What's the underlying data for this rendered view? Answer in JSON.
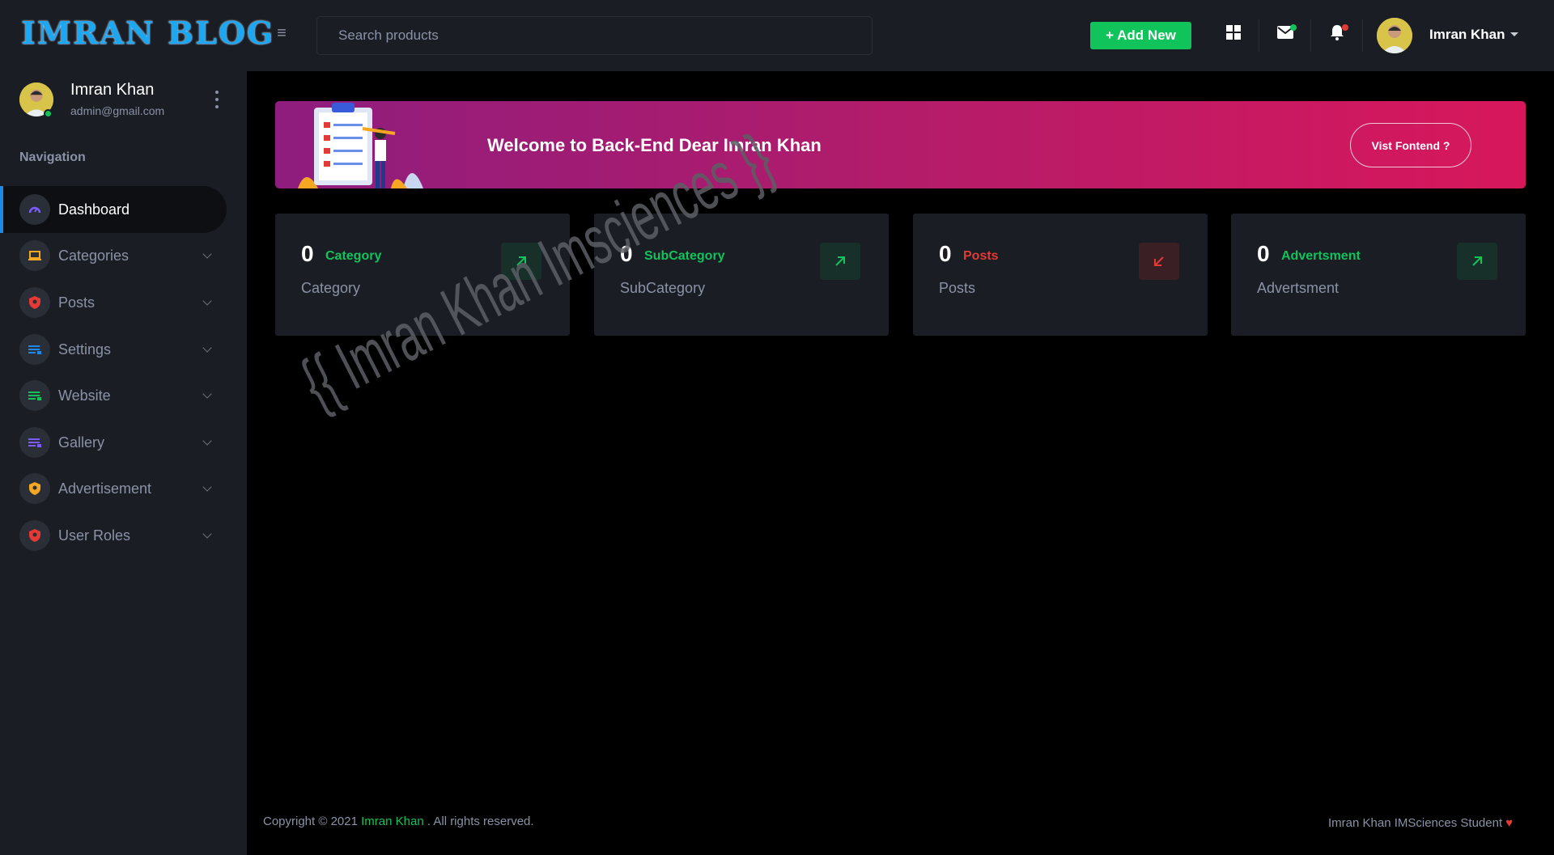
{
  "header": {
    "logo": "IMRAN BLOG",
    "search_placeholder": "Search products",
    "add_new_label": "+ Add New",
    "user_name": "Imran Khan",
    "icons": [
      "hamburger-icon",
      "grid-icon",
      "mail-icon",
      "bell-icon"
    ],
    "colors": {
      "accent_green": "#10c35a",
      "notification_red": "#e53935",
      "logo_blue": "#1da7f0"
    }
  },
  "sidebar": {
    "user_name": "Imran Khan",
    "user_email": "admin@gmail.com",
    "nav_title": "Navigation",
    "items": [
      {
        "label": "Dashboard",
        "icon": "speedometer-icon",
        "icon_color": "#7c5cff",
        "active": true
      },
      {
        "label": "Categories",
        "icon": "laptop-icon",
        "icon_color": "#f5a623",
        "active": false
      },
      {
        "label": "Posts",
        "icon": "shield-icon",
        "icon_color": "#e53935",
        "active": false
      },
      {
        "label": "Settings",
        "icon": "list-icon",
        "icon_color": "#1e88e5",
        "active": false
      },
      {
        "label": "Website",
        "icon": "list-icon",
        "icon_color": "#10c35a",
        "active": false
      },
      {
        "label": "Gallery",
        "icon": "list-icon",
        "icon_color": "#7c5cff",
        "active": false
      },
      {
        "label": "Advertisement",
        "icon": "shield-icon",
        "icon_color": "#f5a623",
        "active": false
      },
      {
        "label": "User Roles",
        "icon": "shield-icon",
        "icon_color": "#e53935",
        "active": false
      }
    ]
  },
  "banner": {
    "welcome_text": "Welcome to Back-End Dear Imran Khan",
    "button_label": "Vist Fontend ?"
  },
  "cards": [
    {
      "count": "0",
      "tag": "Category",
      "subtitle": "Category",
      "tag_color": "#10c35a",
      "trend": "up"
    },
    {
      "count": "0",
      "tag": "SubCategory",
      "subtitle": "SubCategory",
      "tag_color": "#10c35a",
      "trend": "up"
    },
    {
      "count": "0",
      "tag": "Posts",
      "subtitle": "Posts",
      "tag_color": "#e53935",
      "trend": "down"
    },
    {
      "count": "0",
      "tag": "Advertsment",
      "subtitle": "Advertsment",
      "tag_color": "#10c35a",
      "trend": "up"
    }
  ],
  "watermark": "{{ Imran Khan Imsciences }}",
  "footer": {
    "copyright_prefix": "Copyright © 2021",
    "copyright_name": "Imran Khan",
    "copyright_suffix": ". All rights reserved.",
    "right_text": "Imran Khan IMSciences Student"
  }
}
